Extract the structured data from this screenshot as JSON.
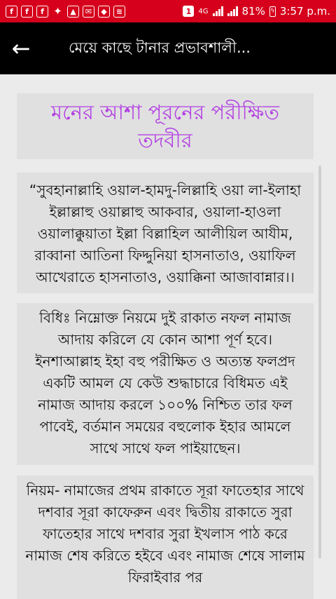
{
  "status_bar": {
    "left_icons": [
      "facebook-icon",
      "facebook-icon",
      "facebook-icon",
      "twitter-icon",
      "image-icon",
      "gmail-icon",
      "bkash-icon",
      "wifi-icon"
    ],
    "notification_count": "1",
    "network_type": "4G",
    "battery_percent": "81%",
    "time": "3:57 p.m."
  },
  "app_bar": {
    "back_icon": "arrow-left-icon",
    "title": "মেয়ে কাছে টানার প্রভাবশালী..."
  },
  "article": {
    "title": "মনের আশা পূরনের পরীক্ষিত তদবীর",
    "dua": "“সুবহানাল্লাহি ওয়াল-হামদু-লিল্লাহি ওয়া লা-ইলাহা ইল্লাল্লাহু ওয়াল্লাহু আকবার, ওয়ালা-হাওলা ওয়ালাক্কুয়াতা ইল্লা বিল্লাহিল আলীয়িল আযীম, রাব্বানা আতিনা ফিদ্দুনিয়া হাসনাতাও, ওয়াফিল আখেরাতে হাসনাতাও, ওয়াক্কিনা আজাবান্নার।।",
    "method": "বিধিঃ নিম্নোক্ত নিয়মে দুই রাকাত নফল নামাজ আদায় করিলে যে কোন আশা পূর্ণ হবে। ইনশাআল্লাহ ইহা বহু পরীক্ষিত ও অত্যন্ত ফলপ্রদ একটি আমল যে কেউ শুদ্ধাচারে বিধিমত এই নামাজ আদায় করলে ১০০% নিশ্চিত তার ফল পাবেই, বর্তমান সময়ের বহুলোক ইহার আমলে সাথে সাথে ফল পাইয়াছেন।",
    "rules": "নিয়ম- নামাজের প্রথম রাকাতে সূরা ফাতেহার সাথে দশবার সূরা কাফেরুন এবং দ্বিতীয় রাকাতে সুরা ফাতেহার সাথে দশবার সুরা ইখলাস পাঠ করে নামাজ শেষ করিতে হইবে এবং নামাজ শেষে সালাম ফিরাইবার পর"
  },
  "colors": {
    "status_bar": "#d6001c",
    "app_bar": "#000000",
    "title_text": "#b341e3",
    "card_background": "#e0e0e0",
    "page_background": "#ebebeb"
  }
}
